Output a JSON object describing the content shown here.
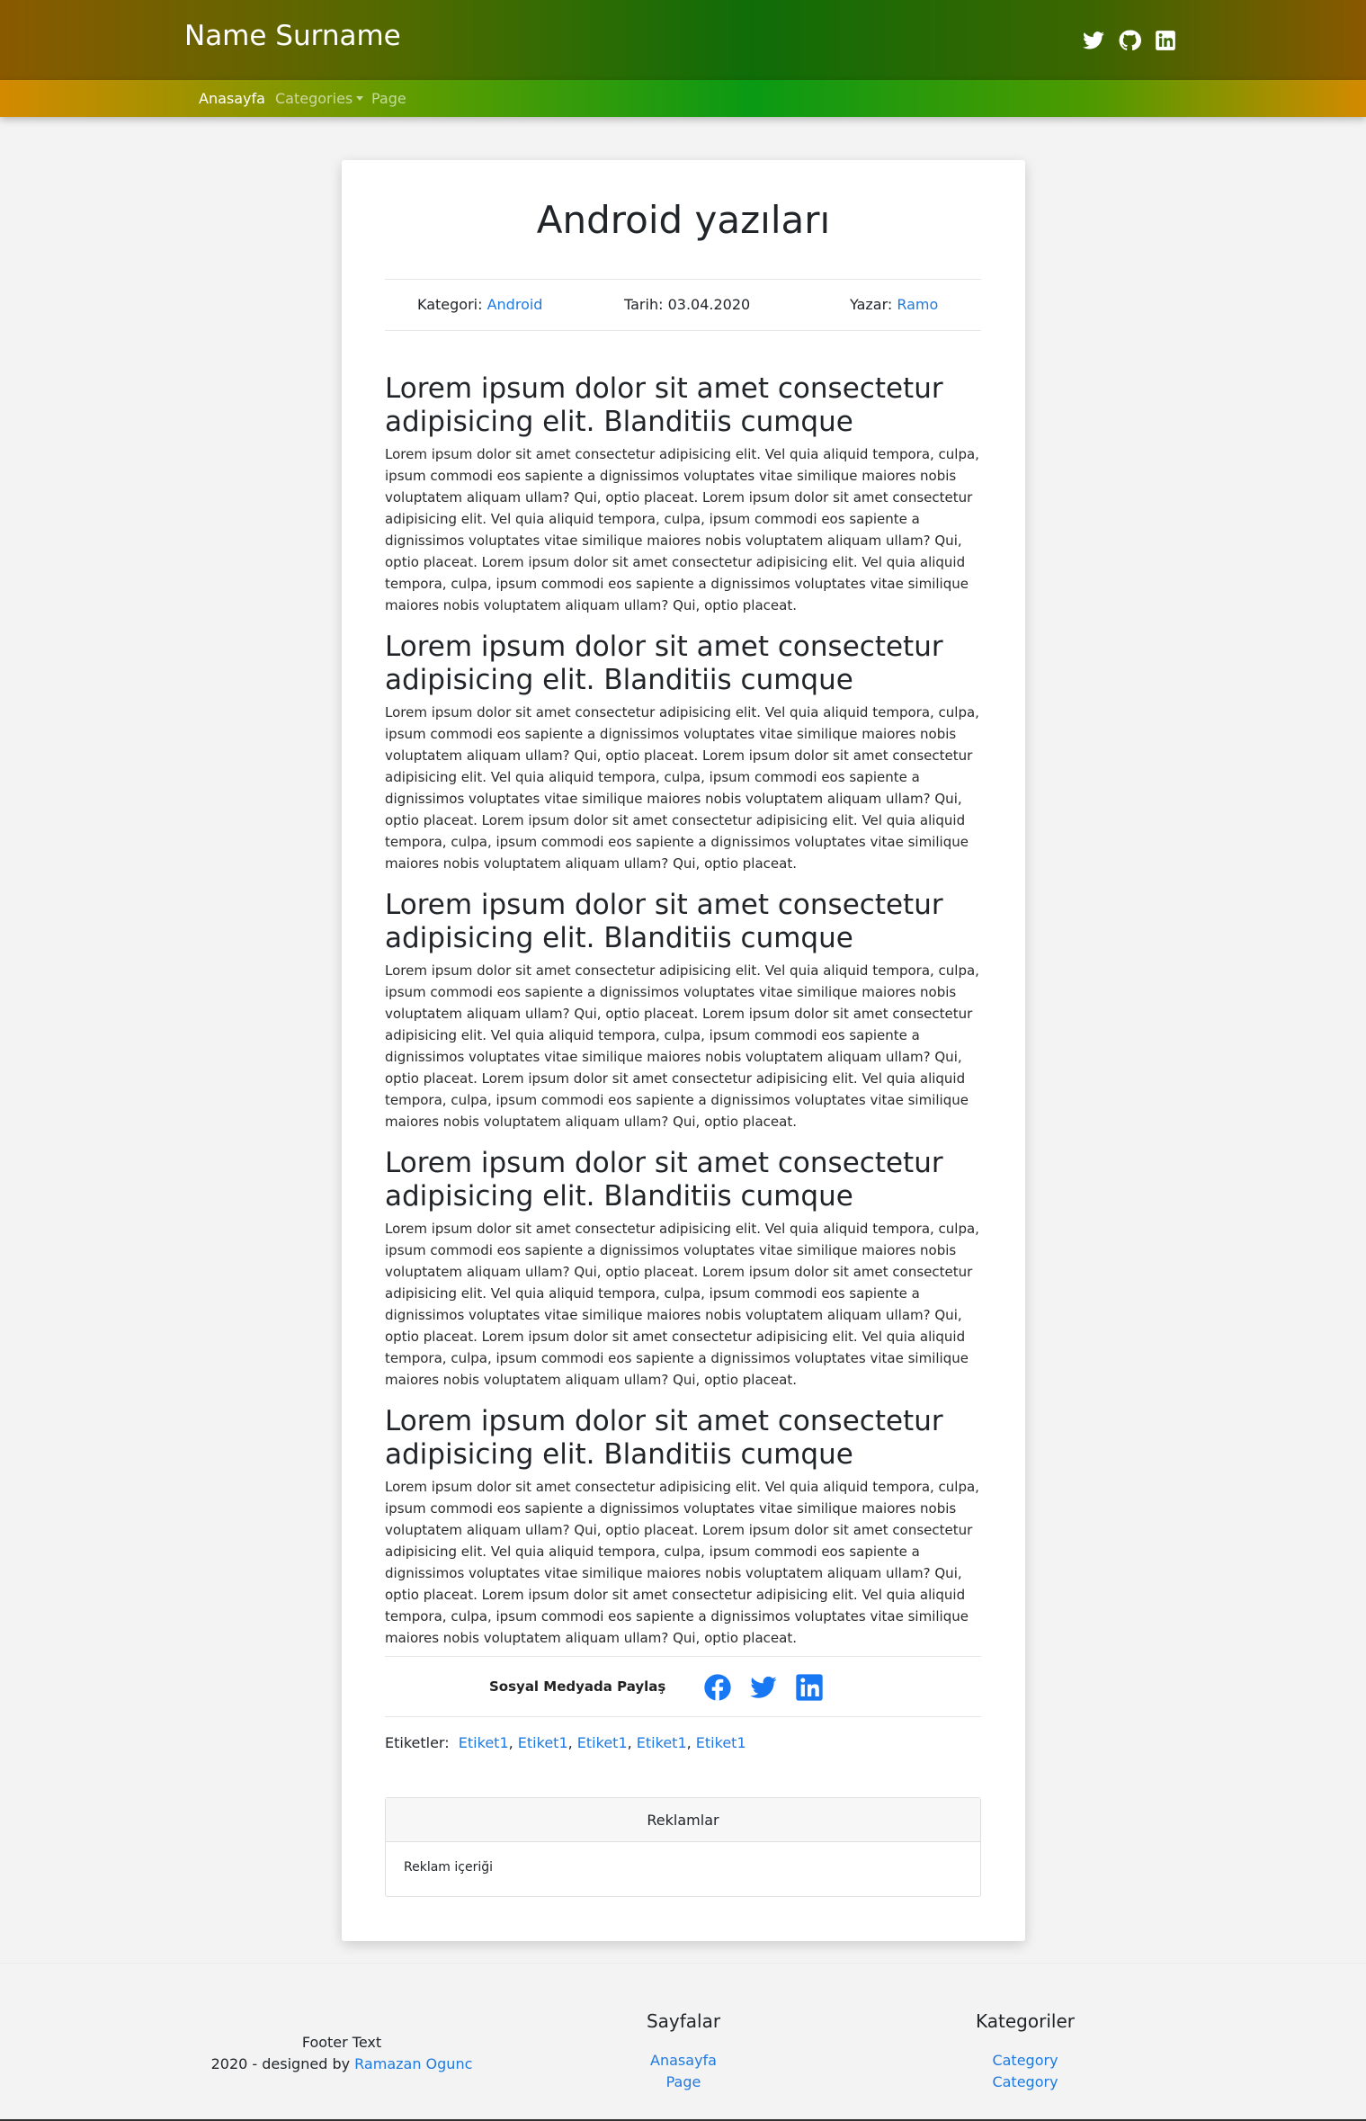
{
  "header": {
    "brand": "Name Surname",
    "social_icons": [
      "twitter-icon",
      "github-icon",
      "linkedin-icon"
    ]
  },
  "nav": {
    "items": [
      {
        "label": "Anasayfa",
        "active": true
      },
      {
        "label": "Categories",
        "dropdown": true
      },
      {
        "label": "Page"
      }
    ]
  },
  "post": {
    "title": "Android yazıları",
    "meta": {
      "category_label": "Kategori:",
      "category_value": "Android",
      "date_label": "Tarih:",
      "date_value": "03.04.2020",
      "author_label": "Yazar:",
      "author_value": "Ramo"
    },
    "sections": [
      {
        "heading": "Lorem ipsum dolor sit amet consectetur adipisicing elit. Blanditiis cumque",
        "body": "Lorem ipsum dolor sit amet consectetur adipisicing elit. Vel quia aliquid tempora, culpa, ipsum commodi eos sapiente a dignissimos voluptates vitae similique maiores nobis voluptatem aliquam ullam? Qui, optio placeat. Lorem ipsum dolor sit amet consectetur adipisicing elit. Vel quia aliquid tempora, culpa, ipsum commodi eos sapiente a dignissimos voluptates vitae similique maiores nobis voluptatem aliquam ullam? Qui, optio placeat. Lorem ipsum dolor sit amet consectetur adipisicing elit. Vel quia aliquid tempora, culpa, ipsum commodi eos sapiente a dignissimos voluptates vitae similique maiores nobis voluptatem aliquam ullam? Qui, optio placeat."
      },
      {
        "heading": "Lorem ipsum dolor sit amet consectetur adipisicing elit. Blanditiis cumque",
        "body": "Lorem ipsum dolor sit amet consectetur adipisicing elit. Vel quia aliquid tempora, culpa, ipsum commodi eos sapiente a dignissimos voluptates vitae similique maiores nobis voluptatem aliquam ullam? Qui, optio placeat. Lorem ipsum dolor sit amet consectetur adipisicing elit. Vel quia aliquid tempora, culpa, ipsum commodi eos sapiente a dignissimos voluptates vitae similique maiores nobis voluptatem aliquam ullam? Qui, optio placeat. Lorem ipsum dolor sit amet consectetur adipisicing elit. Vel quia aliquid tempora, culpa, ipsum commodi eos sapiente a dignissimos voluptates vitae similique maiores nobis voluptatem aliquam ullam? Qui, optio placeat."
      },
      {
        "heading": "Lorem ipsum dolor sit amet consectetur adipisicing elit. Blanditiis cumque",
        "body": "Lorem ipsum dolor sit amet consectetur adipisicing elit. Vel quia aliquid tempora, culpa, ipsum commodi eos sapiente a dignissimos voluptates vitae similique maiores nobis voluptatem aliquam ullam? Qui, optio placeat. Lorem ipsum dolor sit amet consectetur adipisicing elit. Vel quia aliquid tempora, culpa, ipsum commodi eos sapiente a dignissimos voluptates vitae similique maiores nobis voluptatem aliquam ullam? Qui, optio placeat. Lorem ipsum dolor sit amet consectetur adipisicing elit. Vel quia aliquid tempora, culpa, ipsum commodi eos sapiente a dignissimos voluptates vitae similique maiores nobis voluptatem aliquam ullam? Qui, optio placeat."
      },
      {
        "heading": "Lorem ipsum dolor sit amet consectetur adipisicing elit. Blanditiis cumque",
        "body": "Lorem ipsum dolor sit amet consectetur adipisicing elit. Vel quia aliquid tempora, culpa, ipsum commodi eos sapiente a dignissimos voluptates vitae similique maiores nobis voluptatem aliquam ullam? Qui, optio placeat. Lorem ipsum dolor sit amet consectetur adipisicing elit. Vel quia aliquid tempora, culpa, ipsum commodi eos sapiente a dignissimos voluptates vitae similique maiores nobis voluptatem aliquam ullam? Qui, optio placeat. Lorem ipsum dolor sit amet consectetur adipisicing elit. Vel quia aliquid tempora, culpa, ipsum commodi eos sapiente a dignissimos voluptates vitae similique maiores nobis voluptatem aliquam ullam? Qui, optio placeat."
      },
      {
        "heading": "Lorem ipsum dolor sit amet consectetur adipisicing elit. Blanditiis cumque",
        "body": "Lorem ipsum dolor sit amet consectetur adipisicing elit. Vel quia aliquid tempora, culpa, ipsum commodi eos sapiente a dignissimos voluptates vitae similique maiores nobis voluptatem aliquam ullam? Qui, optio placeat. Lorem ipsum dolor sit amet consectetur adipisicing elit. Vel quia aliquid tempora, culpa, ipsum commodi eos sapiente a dignissimos voluptates vitae similique maiores nobis voluptatem aliquam ullam? Qui, optio placeat. Lorem ipsum dolor sit amet consectetur adipisicing elit. Vel quia aliquid tempora, culpa, ipsum commodi eos sapiente a dignissimos voluptates vitae similique maiores nobis voluptatem aliquam ullam? Qui, optio placeat."
      }
    ],
    "share": {
      "label": "Sosyal Medyada Paylaş",
      "icons": [
        "facebook-icon",
        "twitter-icon",
        "linkedin-icon"
      ]
    },
    "tags": {
      "label": "Etiketler:",
      "items": [
        "Etiket1",
        "Etiket1",
        "Etiket1",
        "Etiket1",
        "Etiket1"
      ]
    },
    "ads": {
      "title": "Reklamlar",
      "content": "Reklam içeriği"
    }
  },
  "footer": {
    "text": "Footer Text",
    "credit_prefix": "2020 - designed by",
    "credit_link": "Ramazan Ogunc",
    "pages": {
      "title": "Sayfalar",
      "links": [
        "Anasayfa",
        "Page"
      ]
    },
    "categories": {
      "title": "Kategoriler",
      "links": [
        "Category",
        "Category"
      ]
    }
  },
  "colors": {
    "link": "#1f7ae0",
    "social_blue": "#1877f2"
  }
}
